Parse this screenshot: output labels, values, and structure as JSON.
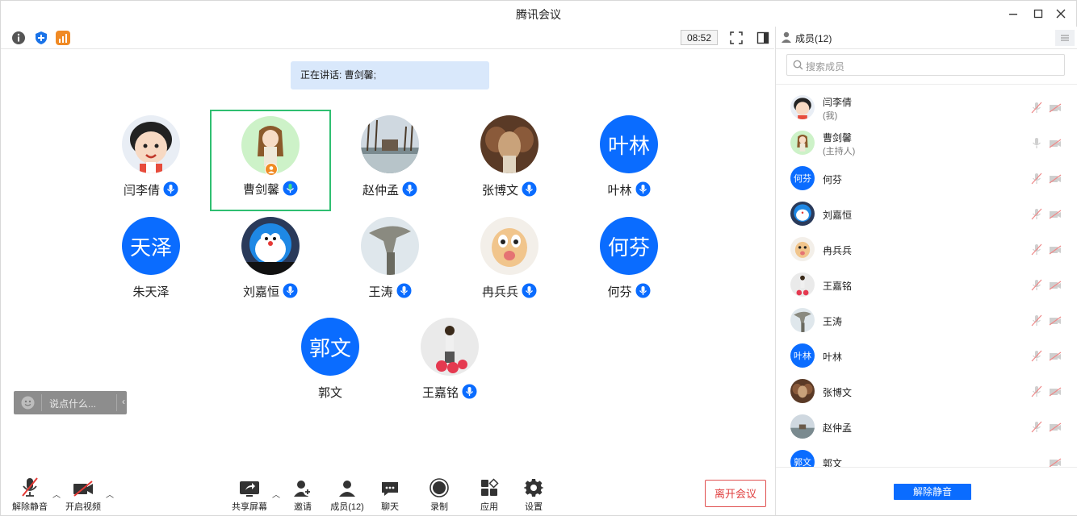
{
  "window": {
    "title": "腾讯会议"
  },
  "toolbar": {
    "time": "08:52"
  },
  "speaking": {
    "text": "正在讲话: 曹剑馨;"
  },
  "tiles": [
    {
      "name": "闫李倩",
      "initials": "",
      "mic": true
    },
    {
      "name": "曹剑馨",
      "initials": "",
      "mic": true,
      "active": true
    },
    {
      "name": "赵仲孟",
      "initials": "",
      "mic": true
    },
    {
      "name": "张博文",
      "initials": "",
      "mic": true
    },
    {
      "name": "叶林",
      "initials": "叶林",
      "mic": true
    },
    {
      "name": "朱天泽",
      "initials": "天泽",
      "mic": false
    },
    {
      "name": "刘嘉恒",
      "initials": "",
      "mic": true
    },
    {
      "name": "王涛",
      "initials": "",
      "mic": true
    },
    {
      "name": "冉兵兵",
      "initials": "",
      "mic": true
    },
    {
      "name": "何芬",
      "initials": "何芬",
      "mic": true
    },
    {
      "name": "郭文",
      "initials": "郭文",
      "mic": false
    },
    {
      "name": "王嘉铭",
      "initials": "",
      "mic": true
    }
  ],
  "chat": {
    "placeholder": "说点什么..."
  },
  "bottom": {
    "unmute": "解除静音",
    "video": "开启视频",
    "share": "共享屏幕",
    "invite": "邀请",
    "members": "成员(12)",
    "chat": "聊天",
    "record": "录制",
    "apps": "应用",
    "settings": "设置",
    "leave": "离开会议"
  },
  "panel": {
    "title": "成员(12)",
    "search_placeholder": "搜索成员",
    "unmute_all": "解除静音",
    "members": [
      {
        "name": "闫李倩",
        "role": "(我)",
        "initials": ""
      },
      {
        "name": "曹剑馨",
        "role": "(主持人)",
        "initials": ""
      },
      {
        "name": "何芬",
        "role": "",
        "initials": "何芬"
      },
      {
        "name": "刘嘉恒",
        "role": "",
        "initials": ""
      },
      {
        "name": "冉兵兵",
        "role": "",
        "initials": ""
      },
      {
        "name": "王嘉铭",
        "role": "",
        "initials": ""
      },
      {
        "name": "王涛",
        "role": "",
        "initials": ""
      },
      {
        "name": "叶林",
        "role": "",
        "initials": "叶林"
      },
      {
        "name": "张博文",
        "role": "",
        "initials": ""
      },
      {
        "name": "赵仲孟",
        "role": "",
        "initials": ""
      },
      {
        "name": "郭文",
        "role": "",
        "initials": "郭文"
      }
    ]
  },
  "colors": {
    "accent": "#0a6cff",
    "active_border": "#2fbf71",
    "leave": "#e04040"
  }
}
